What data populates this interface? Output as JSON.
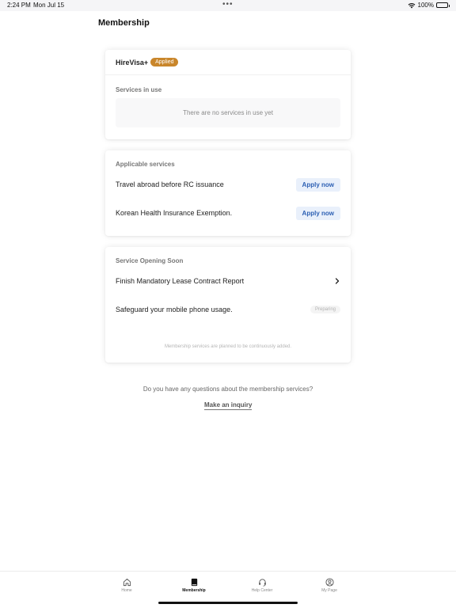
{
  "status_bar": {
    "time": "2:24 PM",
    "date": "Mon Jul 15",
    "battery": "100%"
  },
  "page_title": "Membership",
  "plan": {
    "name": "HireVisa+",
    "badge": "Applied",
    "badge_color": "#c9862b"
  },
  "services_in_use": {
    "label": "Services in use",
    "empty_text": "There are no services in use yet"
  },
  "applicable": {
    "label": "Applicable services",
    "items": [
      {
        "title": "Travel abroad before RC issuance",
        "action": "Apply now"
      },
      {
        "title": "Korean Health Insurance Exemption.",
        "action": "Apply now"
      }
    ]
  },
  "opening_soon": {
    "label": "Service Opening Soon",
    "items": [
      {
        "title": "Finish Mandatory Lease Contract Report"
      },
      {
        "title": "Safeguard your mobile phone usage.",
        "badge": "Preparing"
      }
    ],
    "footnote": "Membership services are planned to be continuously added."
  },
  "inquiry": {
    "question": "Do you have any questions about the membership services?",
    "link": "Make an inquiry"
  },
  "tabs": [
    {
      "label": "Home",
      "icon": "home-icon",
      "active": false
    },
    {
      "label": "Membership",
      "icon": "book-icon",
      "active": true
    },
    {
      "label": "Help Center",
      "icon": "headset-icon",
      "active": false
    },
    {
      "label": "My Page",
      "icon": "user-icon",
      "active": false
    }
  ],
  "colors": {
    "accent": "#2c5fb3",
    "apply_bg": "#e9f0fb"
  }
}
